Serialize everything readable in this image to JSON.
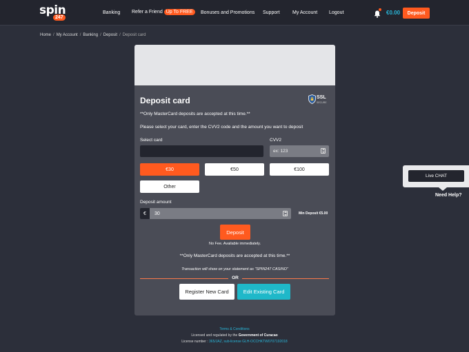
{
  "header": {
    "logo_word": "spin",
    "logo_num": "247",
    "nav": {
      "banking": "Banking",
      "refer": "Refer a Friend",
      "refer_badge": "Up To FREE",
      "bonuses": "Bonuses and Promotions",
      "support": "Support",
      "account": "My Account",
      "logout": "Logout"
    },
    "balance": "€0.00",
    "deposit_label": "Deposit"
  },
  "breadcrumb": {
    "items": [
      "Home",
      "My Account",
      "Banking",
      "Deposit"
    ],
    "separator": "/",
    "current": "Deposit card"
  },
  "card": {
    "title": "Deposit card",
    "ssl": {
      "label": "SSL",
      "sub": "SECURE"
    },
    "note_top": "**Only MasterCard deposits are accepted at this time.**",
    "instruction": "Please select your card, enter the CVV2 code and the amount you want to deposit",
    "select_card_label": "Select card",
    "cvv_label": "CVV2",
    "cvv_placeholder": "ex: 123",
    "amounts": [
      "€30",
      "€50",
      "€100"
    ],
    "other_label": "Other",
    "deposit_amount_label": "Deposit amount",
    "currency": "€",
    "amount_value": "30",
    "min_deposit": "Min Deposit €5.00",
    "deposit_button": "Deposit",
    "no_fee": "No Fee. Available immediately.",
    "note_bottom": "**Only MasterCard deposits are accepted at this time.**",
    "statement": "Transaction will show on your statement as \"SPIN247 CASINO\"",
    "or": "OR",
    "register_button": "Register New Card",
    "edit_button": "Edit Existing Card"
  },
  "footer": {
    "terms": "Terms & Conditions",
    "licensed_prefix": "Licensed and regulated by the",
    "licensed_gov": "Government of Curacao",
    "license_label": "License number :",
    "license_value": "365/JAZ, sub-license GLH-OCCHKTW0707192018"
  },
  "chat": {
    "button": "Live CHAT",
    "help": "Need Help?"
  },
  "colors": {
    "accent": "#ff5a1f",
    "teal": "#1fb8c9",
    "link": "#29b6d8"
  }
}
